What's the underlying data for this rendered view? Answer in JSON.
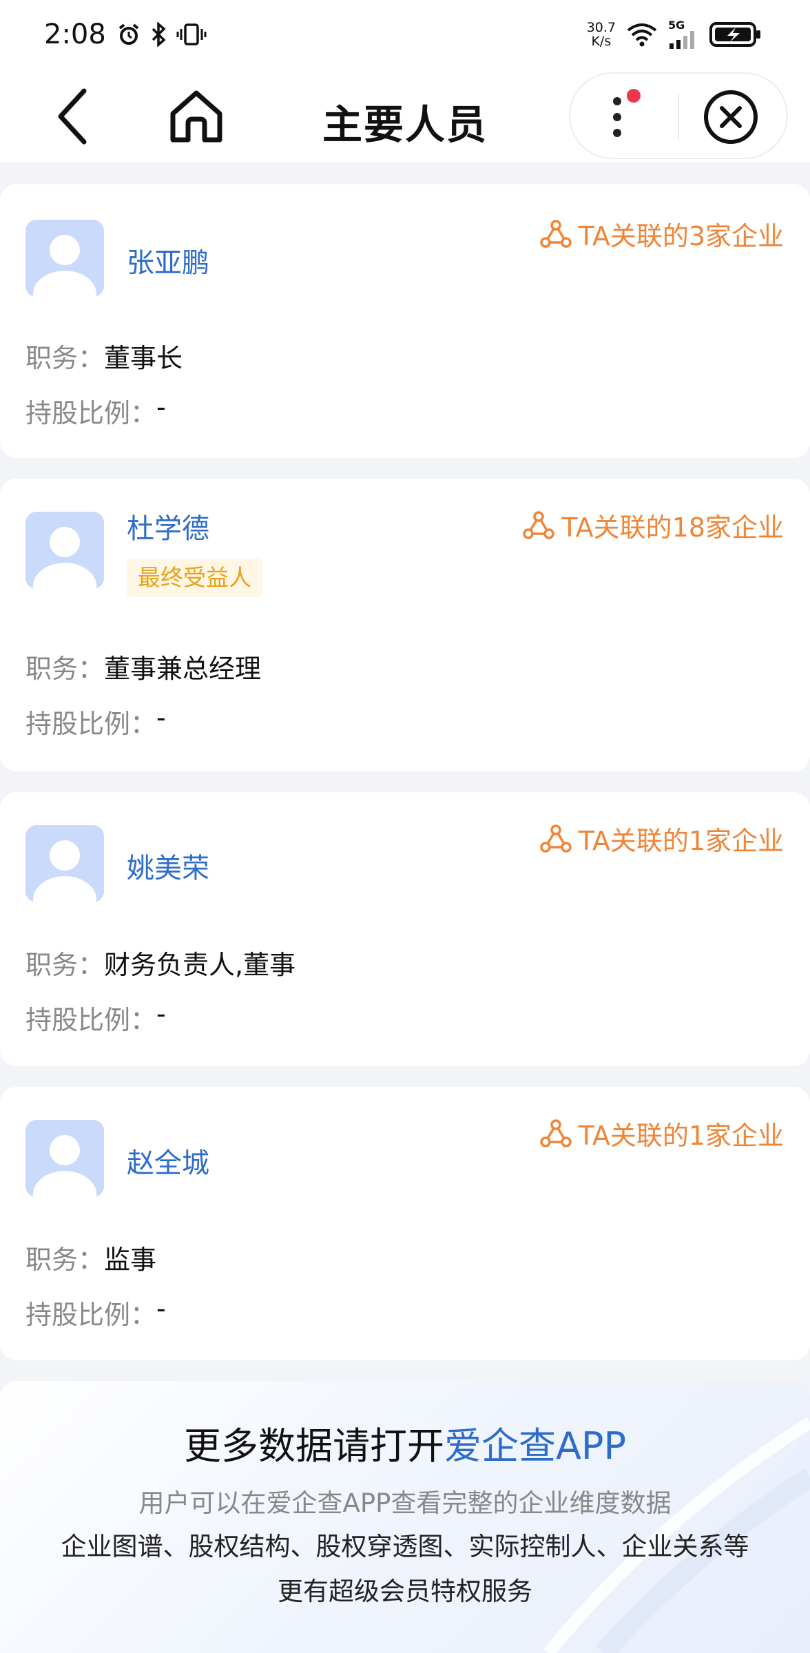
{
  "status_bar": {
    "time": "2:08",
    "net_speed_value": "30.7",
    "net_speed_unit": "K/s",
    "signal_label": "5G"
  },
  "nav": {
    "title": "主要人员"
  },
  "people": [
    {
      "name": "张亚鹏",
      "related": "TA关联的3家企业",
      "role_label": "职务：",
      "role": "董事长",
      "share_label": "持股比例：",
      "share": "-"
    },
    {
      "name": "杜学德",
      "tag": "最终受益人",
      "related": "TA关联的18家企业",
      "role_label": "职务：",
      "role": "董事兼总经理",
      "share_label": "持股比例：",
      "share": "-"
    },
    {
      "name": "姚美荣",
      "related": "TA关联的1家企业",
      "role_label": "职务：",
      "role": "财务负责人,董事",
      "share_label": "持股比例：",
      "share": "-"
    },
    {
      "name": "赵全城",
      "related": "TA关联的1家企业",
      "role_label": "职务：",
      "role": "监事",
      "share_label": "持股比例：",
      "share": "-"
    }
  ],
  "promo": {
    "title_prefix": "更多数据请打开",
    "title_brand": "爱企查APP",
    "subtitle": "用户可以在爱企查APP查看完整的企业维度数据",
    "line2": "企业图谱、股权结构、股权穿透图、实际控制人、企业关系等",
    "line3": "更有超级会员特权服务"
  },
  "colors": {
    "accent_blue": "#2d6cc9",
    "related_orange": "#ef8537",
    "tag_yellow": "#e6a21a",
    "tag_bg": "#fff6e5",
    "badge_red": "#f0364f"
  },
  "icons": [
    "alarm-icon",
    "bluetooth-icon",
    "vibrate-icon",
    "wifi-icon",
    "signal-icon",
    "battery-charging-icon",
    "back-icon",
    "home-icon",
    "more-icon",
    "close-icon",
    "network-icon"
  ]
}
